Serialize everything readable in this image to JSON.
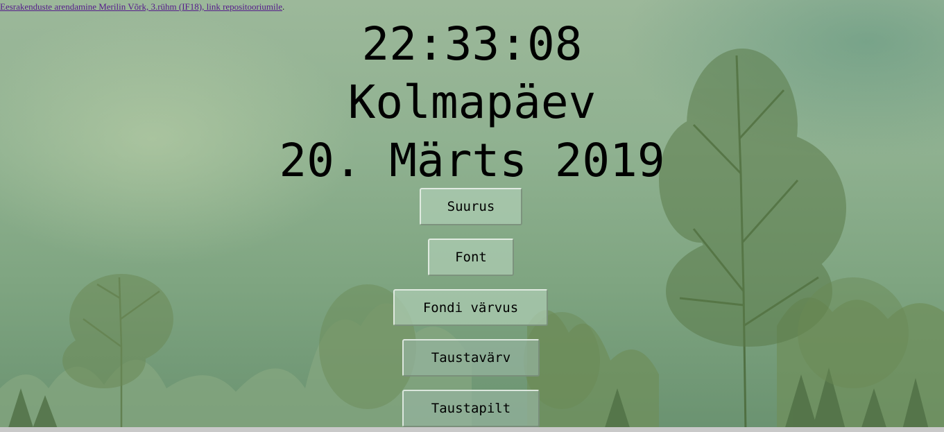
{
  "header": {
    "link_text": "Eesrakenduste arendamine Merilin Võrk, 3.rühm (IF18), link repositooriumile",
    "trailing": "."
  },
  "clock": {
    "time": "22:33:08",
    "weekday": "Kolmapäev",
    "date": "20. Märts 2019"
  },
  "buttons": {
    "size": "Suurus",
    "font": "Font",
    "font_color": "Fondi värvus",
    "bg_color": "Taustavärv",
    "bg_image": "Taustapilt"
  },
  "colors": {
    "sky": "#9cb89a",
    "trees": "#5f7f4e",
    "link": "#551a8b"
  }
}
